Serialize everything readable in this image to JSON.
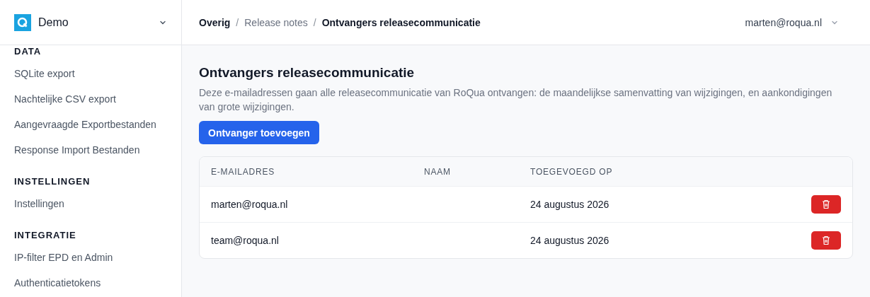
{
  "sidebar": {
    "org": "Demo",
    "sections": [
      {
        "heading": "DATA",
        "items": [
          "SQLite export",
          "Nachtelijke CSV export",
          "Aangevraagde Exportbestanden",
          "Response Import Bestanden"
        ]
      },
      {
        "heading": "INSTELLINGEN",
        "items": [
          "Instellingen"
        ]
      },
      {
        "heading": "INTEGRATIE",
        "items": [
          "IP-filter EPD en Admin",
          "Authenticatietokens"
        ]
      }
    ]
  },
  "breadcrumbs": [
    {
      "label": "Overig",
      "strong": true
    },
    {
      "separator": "/",
      "label": "Release notes",
      "strong": false
    },
    {
      "separator": "/",
      "label": "Ontvangers releasecommunicatie",
      "strong": true
    }
  ],
  "user": "marten@roqua.nl",
  "page": {
    "title": "Ontvangers releasecommunicatie",
    "description": "Deze e-mailadressen gaan alle releasecommunicatie van RoQua ontvangen: de maandelijkse samenvatting van wijzigingen, en aankondigingen van grote wijzigingen.",
    "button": "Ontvanger toevoegen"
  },
  "table": {
    "columns": [
      "E-MAILADRES",
      "NAAM",
      "TOEGEVOEGD OP"
    ],
    "rows": [
      {
        "email": "marten@roqua.nl",
        "added": "24 augustus 2026"
      },
      {
        "email": "team@roqua.nl",
        "added": "24 augustus 2026"
      }
    ]
  }
}
